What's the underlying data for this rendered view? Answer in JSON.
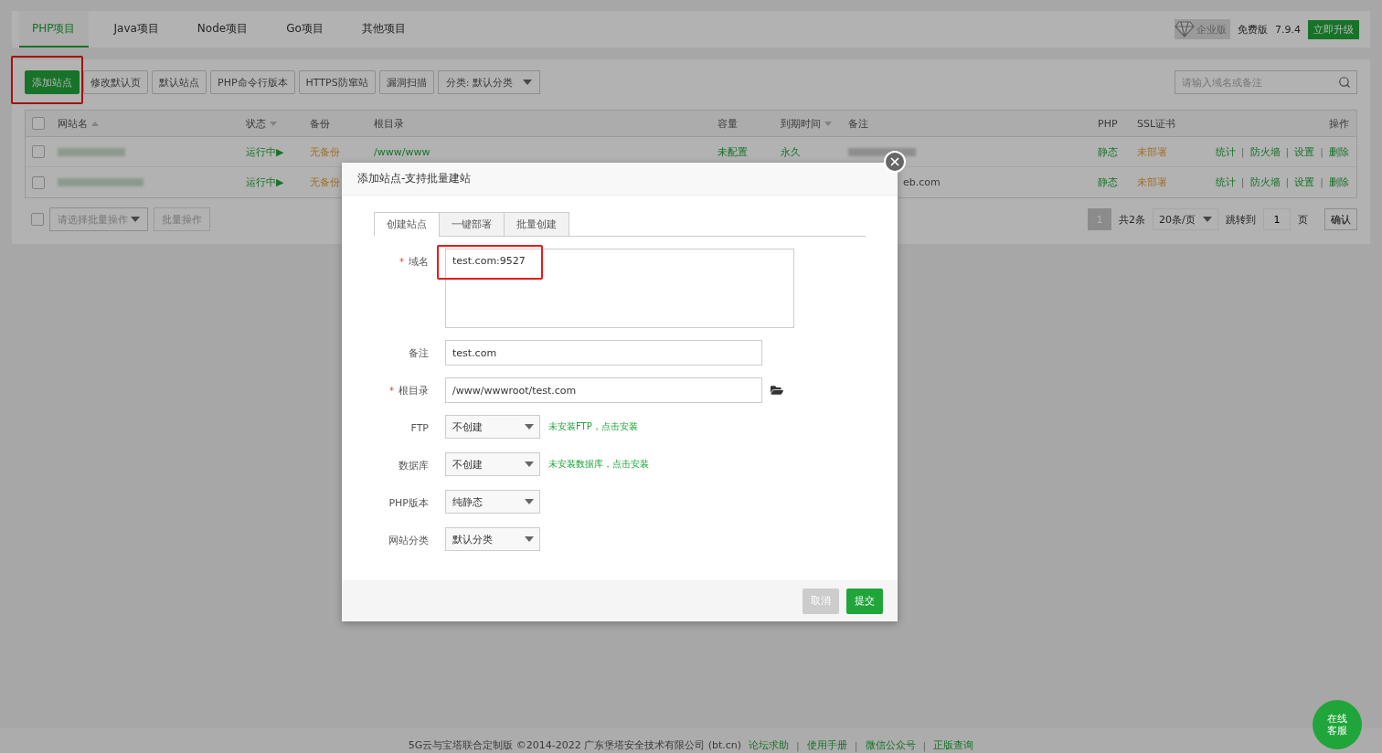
{
  "project_tabs": [
    {
      "label": "PHP项目",
      "selected": true
    },
    {
      "label": "Java项目",
      "selected": false
    },
    {
      "label": "Node项目",
      "selected": false
    },
    {
      "label": "Go项目",
      "selected": false
    },
    {
      "label": "其他项目",
      "selected": false
    }
  ],
  "edition": {
    "badge": "企业版",
    "free_label": "免费版",
    "version": "7.9.4",
    "upgrade": "立即升级"
  },
  "toolbar": {
    "buttons": [
      {
        "label": "添加站点",
        "kind": "primary",
        "highlighted": true
      },
      {
        "label": "修改默认页",
        "kind": "default",
        "highlighted": false
      },
      {
        "label": "默认站点",
        "kind": "default",
        "highlighted": false
      },
      {
        "label": "PHP命令行版本",
        "kind": "default",
        "highlighted": false
      },
      {
        "label": "HTTPS防窜站",
        "kind": "default",
        "highlighted": false
      },
      {
        "label": "漏洞扫描",
        "kind": "default",
        "highlighted": false
      }
    ],
    "category_select": "分类: 默认分类",
    "search_placeholder": "请输入域名或备注"
  },
  "table": {
    "all_checked": false,
    "columns": [
      {
        "label": "网站名",
        "sort_up": true,
        "sort_down": false
      },
      {
        "label": "状态",
        "sort_up": false,
        "sort_down": true
      },
      {
        "label": "备份",
        "sort_up": false,
        "sort_down": false
      },
      {
        "label": "根目录",
        "sort_up": false,
        "sort_down": false
      },
      {
        "label": "容量",
        "sort_up": false,
        "sort_down": false
      },
      {
        "label": "到期时间",
        "sort_up": false,
        "sort_down": true
      },
      {
        "label": "备注",
        "sort_up": false,
        "sort_down": false
      },
      {
        "label": "PHP",
        "sort_up": false,
        "sort_down": false
      },
      {
        "label": "SSL证书",
        "sort_up": false,
        "sort_down": false
      },
      {
        "label": "操作",
        "sort_up": false,
        "sort_down": false
      }
    ],
    "action_separator": "|",
    "rows": [
      {
        "checked": false,
        "status": "运行中▶",
        "backup": "无备份",
        "root": "/www/www",
        "capacity": "未配置",
        "expiry": "永久",
        "php": "静态",
        "ssl": "未部署",
        "actions": [
          "统计",
          "防火墙",
          "设置",
          "删除"
        ]
      },
      {
        "checked": false,
        "status": "运行中▶",
        "backup": "无备份",
        "note": "eb.com",
        "php": "静态",
        "ssl": "未部署",
        "actions": [
          "统计",
          "防火墙",
          "设置",
          "删除"
        ]
      }
    ]
  },
  "bulk": {
    "checked": false,
    "select_placeholder": "请选择批量操作",
    "button": "批量操作"
  },
  "pagination": {
    "pages": [
      {
        "label": "1",
        "selected": true
      }
    ],
    "total": "共2条",
    "page_size": "20条/页",
    "jump_label": "跳转到",
    "jump_value": "1",
    "page_unit": "页",
    "confirm": "确认"
  },
  "dialog": {
    "title": "添加站点-支持批量建站",
    "tabs": [
      {
        "label": "创建站点",
        "selected": true
      },
      {
        "label": "一键部署",
        "selected": false
      },
      {
        "label": "批量创建",
        "selected": false
      }
    ],
    "required_mark": "*",
    "fields": [
      {
        "kind": "textarea",
        "label": "域名",
        "required": true,
        "value": "test.com:9527",
        "highlighted": true
      },
      {
        "kind": "text",
        "label": "备注",
        "required": false,
        "value": "test.com",
        "highlighted": false
      },
      {
        "kind": "path",
        "label": "根目录",
        "required": true,
        "value": "/www/wwwroot/test.com",
        "highlighted": false
      },
      {
        "kind": "select",
        "label": "FTP",
        "required": false,
        "value": "不创建",
        "hint": "未安装FTP，点击安装",
        "highlighted": false
      },
      {
        "kind": "select",
        "label": "数据库",
        "required": false,
        "value": "不创建",
        "hint": "未安装数据库，点击安装",
        "highlighted": false
      },
      {
        "kind": "select",
        "label": "PHP版本",
        "required": false,
        "value": "纯静态",
        "highlighted": false
      },
      {
        "kind": "select",
        "label": "网站分类",
        "required": false,
        "value": "默认分类",
        "highlighted": false
      }
    ],
    "buttons": [
      {
        "label": "取消",
        "kind": "cancel"
      },
      {
        "label": "提交",
        "kind": "primary"
      }
    ]
  },
  "footer": {
    "copyright": "5G云与宝塔联合定制版 ©2014-2022 广东堡塔安全技术有限公司 (bt.cn)",
    "links": [
      "论坛求助",
      "使用手册",
      "微信公众号",
      "正版查询"
    ],
    "separator": "|"
  },
  "support_bubble": "在线客服"
}
